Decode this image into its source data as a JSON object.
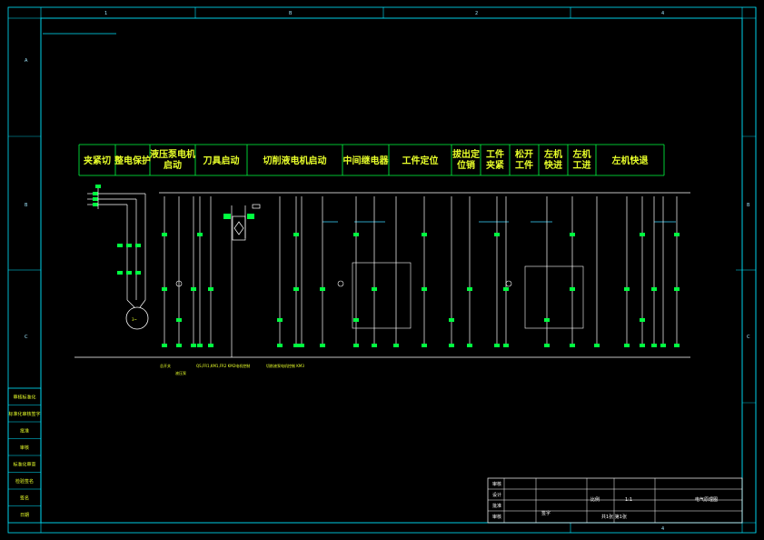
{
  "colors": {
    "background": "#000000",
    "frame": "#00e5ff",
    "header_text": "#e8ff2a",
    "header_box": "#00ff40",
    "wire": "#ffffff",
    "contact": "#00ff40",
    "bus": "#3ad6ff"
  },
  "zones": {
    "top": [
      "1",
      "B",
      "2",
      "4"
    ],
    "left": [
      "A",
      "B",
      "C"
    ],
    "right": [
      "B",
      "C"
    ],
    "bottom": [
      "4"
    ]
  },
  "header": {
    "cells": [
      "夹紧切",
      "整电保护",
      "液压泵电机\n启动",
      "刀具启动",
      "切削液电机启动",
      "中间继电器",
      "工件定位",
      "拔出定\n位销",
      "工件\n夹紧",
      "松开\n工件",
      "左机\n快进",
      "左机\n工进",
      "左机快退"
    ]
  },
  "motor": {
    "label": "3~"
  },
  "captions": {
    "c1": "总开关",
    "c2": "液压泵",
    "c3": "QS,FR1,KM1,FR2\nKM2电机控制",
    "c4": "切削液泵电机控制\nKM3"
  },
  "left_column": [
    "审核标准化",
    "标准化审核签字",
    "批准",
    "审核",
    "标准化审查",
    "检验签名",
    "签名",
    "日期"
  ],
  "title_block": {
    "rows": [
      "审核",
      "设计",
      "批准",
      "审核"
    ],
    "name": "电气原理图",
    "scale": "比例",
    "qty": "1:1",
    "sheet": "共1张 第1张",
    "drawn": "签字"
  }
}
